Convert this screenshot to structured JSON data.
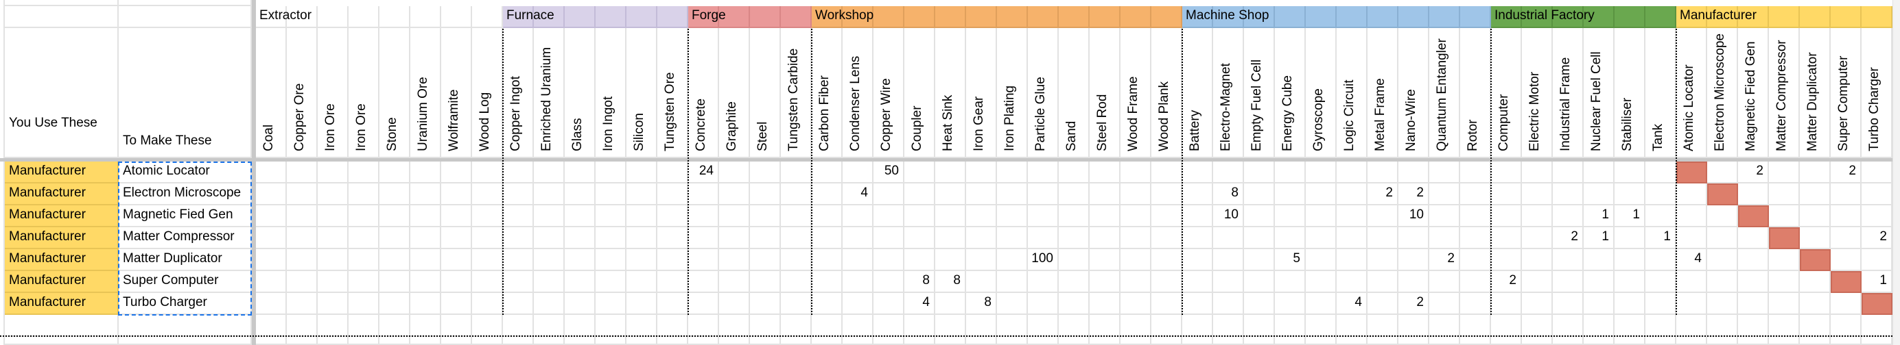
{
  "headers": {
    "col_a_label": "You Use These",
    "col_b_label": "To Make These"
  },
  "groups": [
    {
      "name": "Extractor",
      "color": "#ffffff",
      "border": "#e2e2e2",
      "items": [
        "Coal",
        "Copper Ore",
        "Iron Ore",
        "Iron Ore",
        "Stone",
        "Uranium Ore",
        "Wolframite",
        "Wood Log"
      ]
    },
    {
      "name": "Furnace",
      "color": "#d9d2e9",
      "border": "#c3bbd8",
      "items": [
        "Copper Ingot",
        "Enriched Uranium",
        "Glass",
        "Iron Ingot",
        "Silicon",
        "Tungsten Ore"
      ]
    },
    {
      "name": "Forge",
      "color": "#ea9999",
      "border": "#d98686",
      "items": [
        "Concrete",
        "Graphite",
        "Steel",
        "Tungsten Carbide"
      ]
    },
    {
      "name": "Workshop",
      "color": "#f6b26b",
      "border": "#e0a05c",
      "items": [
        "Carbon Fiber",
        "Condenser Lens",
        "Copper Wire",
        "Coupler",
        "Heat Sink",
        "Iron Gear",
        "Iron Plating",
        "Particle Glue",
        "Sand",
        "Steel Rod",
        "Wood Frame",
        "Wood Plank"
      ]
    },
    {
      "name": "Machine Shop",
      "color": "#9fc5e8",
      "border": "#8ab0d3",
      "items": [
        "Battery",
        "Electro-Magnet",
        "Empty Fuel Cell",
        "Energy Cube",
        "Gyroscope",
        "Logic Circuit",
        "Metal Frame",
        "Nano-Wire",
        "Quantum Entangler",
        "Rotor"
      ]
    },
    {
      "name": "Industrial Factory",
      "color": "#6aa84f",
      "border": "#5a9441",
      "items": [
        "Computer",
        "Electric Motor",
        "Industrial Frame",
        "Nuclear Fuel Cell",
        "Stabiliser",
        "Tank"
      ]
    },
    {
      "name": "Manufacturer",
      "color": "#ffd966",
      "border": "#e8c455",
      "items": [
        "Atomic Locator",
        "Electron Microscope",
        "Magnetic Fied Gen",
        "Matter Compressor",
        "Matter Duplicator",
        "Super Computer",
        "Turbo Charger"
      ]
    }
  ],
  "rows": [
    {
      "use": "Manufacturer",
      "make": "Atomic Locator",
      "values": {
        "Forge.Concrete": 24,
        "Workshop.Copper Wire": 50,
        "Manufacturer.Magnetic Fied Gen": 2,
        "Manufacturer.Super Computer": 2
      },
      "self": "Manufacturer.Atomic Locator"
    },
    {
      "use": "Manufacturer",
      "make": "Electron Microscope",
      "values": {
        "Workshop.Condenser Lens": 4,
        "Machine Shop.Electro-Magnet": 8,
        "Machine Shop.Metal Frame": 2,
        "Machine Shop.Nano-Wire": 2
      },
      "self": "Manufacturer.Electron Microscope"
    },
    {
      "use": "Manufacturer",
      "make": "Magnetic Fied Gen",
      "values": {
        "Machine Shop.Electro-Magnet": 10,
        "Machine Shop.Nano-Wire": 10,
        "Industrial Factory.Nuclear Fuel Cell": 1,
        "Industrial Factory.Stabiliser": 1
      },
      "self": "Manufacturer.Magnetic Fied Gen"
    },
    {
      "use": "Manufacturer",
      "make": "Matter Compressor",
      "values": {
        "Industrial Factory.Industrial Frame": 2,
        "Industrial Factory.Nuclear Fuel Cell": 1,
        "Industrial Factory.Tank": 1,
        "Manufacturer.Turbo Charger": 2
      },
      "self": "Manufacturer.Matter Compressor"
    },
    {
      "use": "Manufacturer",
      "make": "Matter Duplicator",
      "values": {
        "Workshop.Particle Glue": 100,
        "Machine Shop.Energy Cube": 5,
        "Machine Shop.Quantum Entangler": 2,
        "Manufacturer.Atomic Locator": 4
      },
      "self": "Manufacturer.Matter Duplicator"
    },
    {
      "use": "Manufacturer",
      "make": "Super Computer",
      "values": {
        "Workshop.Coupler": 8,
        "Workshop.Heat Sink": 8,
        "Industrial Factory.Computer": 2,
        "Manufacturer.Turbo Charger": 1
      },
      "self": "Manufacturer.Super Computer"
    },
    {
      "use": "Manufacturer",
      "make": "Turbo Charger",
      "values": {
        "Workshop.Coupler": 4,
        "Workshop.Iron Gear": 8,
        "Machine Shop.Logic Circuit": 4,
        "Machine Shop.Nano-Wire": 2
      },
      "self": "Manufacturer.Turbo Charger"
    }
  ],
  "colors": {
    "use_cell_bg": "#ffd966",
    "self_cell_bg": "#dd7e6b",
    "selection_border": "#1a73e8"
  }
}
